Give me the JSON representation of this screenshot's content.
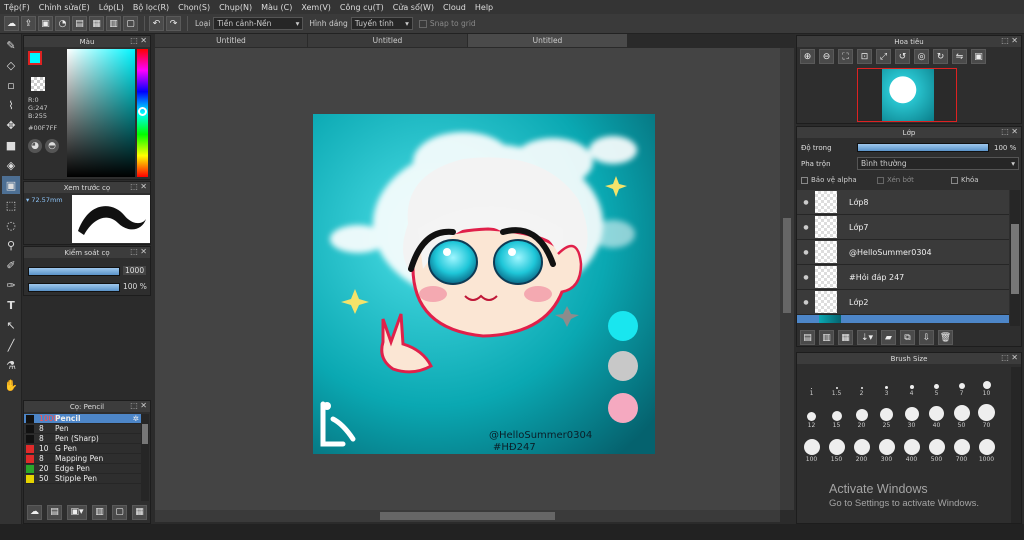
{
  "menu": [
    "Tệp(F)",
    "Chỉnh sửa(E)",
    "Lớp(L)",
    "Bộ lọc(R)",
    "Chọn(S)",
    "Chụp(N)",
    "Màu (C)",
    "Xem(V)",
    "Công cụ(T)",
    "Cửa sổ(W)",
    "Cloud",
    "Help"
  ],
  "toolbar": {
    "loai_label": "Loại",
    "loai_value": "Tiền cảnh-Nền",
    "hinh_dang_label": "Hình dáng",
    "hinh_dang_value": "Tuyến tính",
    "snap_label": "Snap to grid"
  },
  "tabs": [
    "Untitled",
    "Untitled",
    "Untitled"
  ],
  "color_panel": {
    "title": "Màu",
    "r": "R:0",
    "g": "G:247",
    "b": "B:255",
    "hex": "#00F7FF",
    "foreground": "#00F7FF"
  },
  "preview_panel": {
    "title": "Xem trước cọ",
    "size": "72.57mm"
  },
  "control_panel": {
    "title": "Kiểm soát cọ",
    "size_value": "1000",
    "opacity_value": "100 %",
    "size_fill": 1.0,
    "opacity_fill": 1.0
  },
  "brush_panel": {
    "title": "Cọ: Pencil",
    "items": [
      {
        "size": "1000",
        "name": "Pencil",
        "color": "#111111"
      },
      {
        "size": "8",
        "name": "Pen",
        "color": "#111111"
      },
      {
        "size": "8",
        "name": "Pen (Sharp)",
        "color": "#111111"
      },
      {
        "size": "10",
        "name": "G Pen",
        "color": "#e02a2a"
      },
      {
        "size": "8",
        "name": "Mapping Pen",
        "color": "#e02a2a"
      },
      {
        "size": "20",
        "name": "Edge Pen",
        "color": "#2aa52a"
      },
      {
        "size": "50",
        "name": "Stipple Pen",
        "color": "#e6d400"
      }
    ]
  },
  "navigator": {
    "title": "Hoa tiêu"
  },
  "layer_panel": {
    "title": "Lớp",
    "opacity_label": "Độ trong",
    "opacity_value": "100 %",
    "opacity_fill": 1.0,
    "blend_label": "Pha trộn",
    "blend_value": "Bình thường",
    "protect_alpha": "Bảo vệ alpha",
    "clipping": "Xén bớt",
    "lock": "Khóa",
    "layers": [
      "Lớp8",
      "Lớp7",
      "@HelloSummer0304",
      "#Hỏi đáp 247",
      "Lớp2"
    ]
  },
  "brush_size": {
    "title": "Brush Size",
    "row1": [
      "1",
      "1.5",
      "2",
      "3",
      "4",
      "5",
      "7",
      "10"
    ],
    "row2": [
      "12",
      "15",
      "20",
      "25",
      "30",
      "40",
      "50",
      "70"
    ],
    "row3": [
      "100",
      "150",
      "200",
      "300",
      "400",
      "500",
      "700",
      "1000"
    ]
  },
  "watermark": {
    "line1": "Activate Windows",
    "line2": "Go to Settings to activate Windows."
  },
  "artwork": {
    "signature_line1": "@HelloSummer0304",
    "signature_line2": "#HĐ247"
  },
  "colors": {
    "swatch1": "#19e6ef",
    "swatch2": "#c8c8c8",
    "swatch3": "#f5a9c0",
    "canvas_bg": "#10b3bc"
  }
}
